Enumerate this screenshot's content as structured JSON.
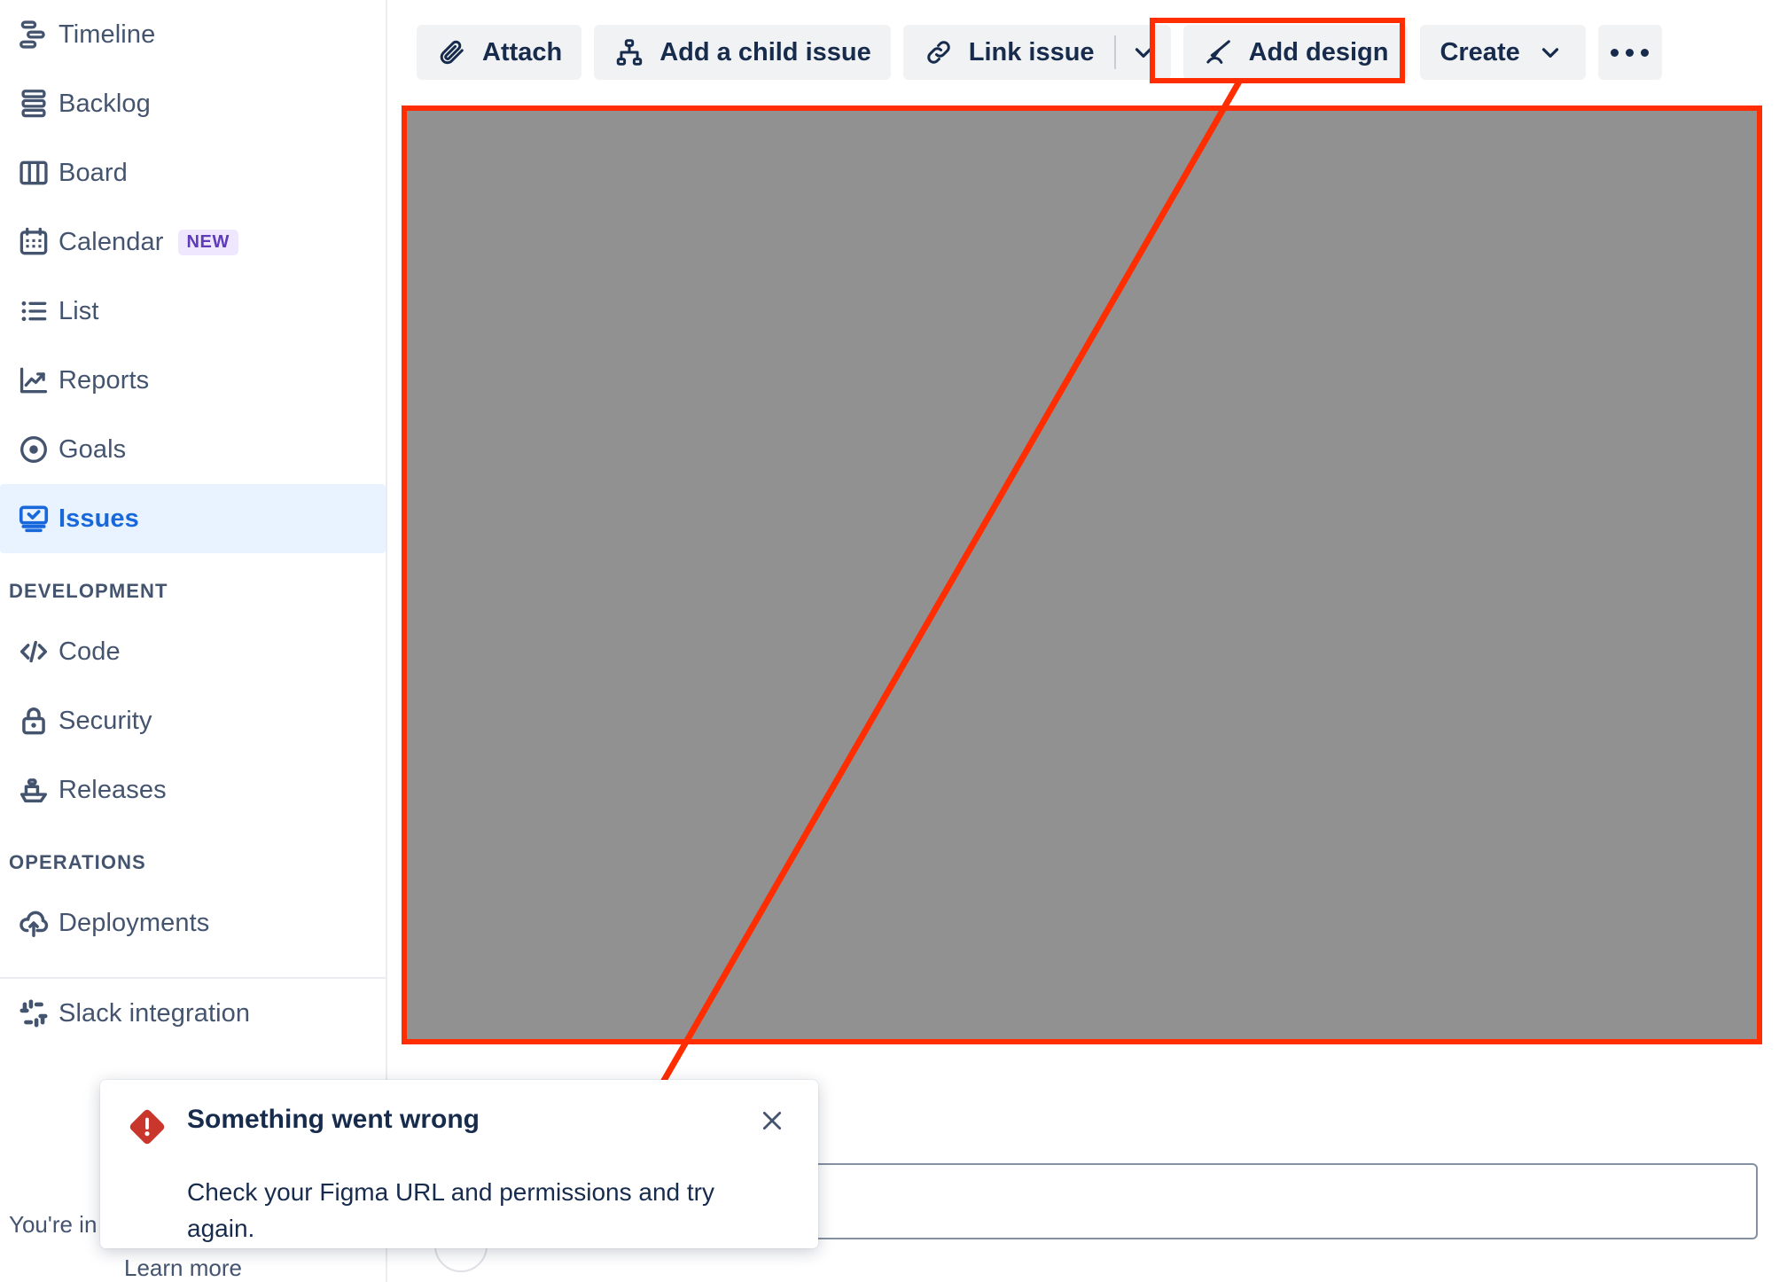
{
  "sidebar": {
    "items": [
      {
        "label": "Timeline",
        "icon": "timeline-icon",
        "active": false
      },
      {
        "label": "Backlog",
        "icon": "backlog-icon",
        "active": false
      },
      {
        "label": "Board",
        "icon": "board-icon",
        "active": false
      },
      {
        "label": "Calendar",
        "icon": "calendar-icon",
        "active": false,
        "badge": "NEW"
      },
      {
        "label": "List",
        "icon": "list-icon",
        "active": false
      },
      {
        "label": "Reports",
        "icon": "reports-icon",
        "active": false
      },
      {
        "label": "Goals",
        "icon": "goals-icon",
        "active": false
      },
      {
        "label": "Issues",
        "icon": "issues-icon",
        "active": true
      }
    ],
    "sections": [
      {
        "title": "DEVELOPMENT",
        "items": [
          {
            "label": "Code",
            "icon": "code-icon"
          },
          {
            "label": "Security",
            "icon": "lock-icon"
          },
          {
            "label": "Releases",
            "icon": "ship-icon"
          }
        ]
      },
      {
        "title": "OPERATIONS",
        "items": [
          {
            "label": "Deployments",
            "icon": "cloud-upload-icon"
          }
        ]
      }
    ],
    "after_divider": [
      {
        "label": "Slack integration",
        "icon": "slack-icon"
      }
    ],
    "footer_text": "You're in a",
    "footer_link": "Learn more"
  },
  "toolbar": {
    "attach_label": "Attach",
    "add_child_label": "Add a child issue",
    "link_issue_label": "Link issue",
    "add_design_label": "Add design",
    "create_label": "Create",
    "more_label": "•••"
  },
  "toast": {
    "title": "Something went wrong",
    "message": "Check your Figma URL and permissions and try again.",
    "close_label": "✕"
  },
  "annotation": {
    "accent_color": "#FF2D00",
    "target": "Add design"
  },
  "colors": {
    "panel_gray": "#919191",
    "sidebar_active_bg": "#E9F2FF",
    "sidebar_active_fg": "#1868DB",
    "nav_fg": "#44546F",
    "button_bg": "#F1F2F4",
    "error_red": "#C9372C",
    "badge_bg": "#EFE7FE",
    "badge_fg": "#5E3BB8"
  }
}
